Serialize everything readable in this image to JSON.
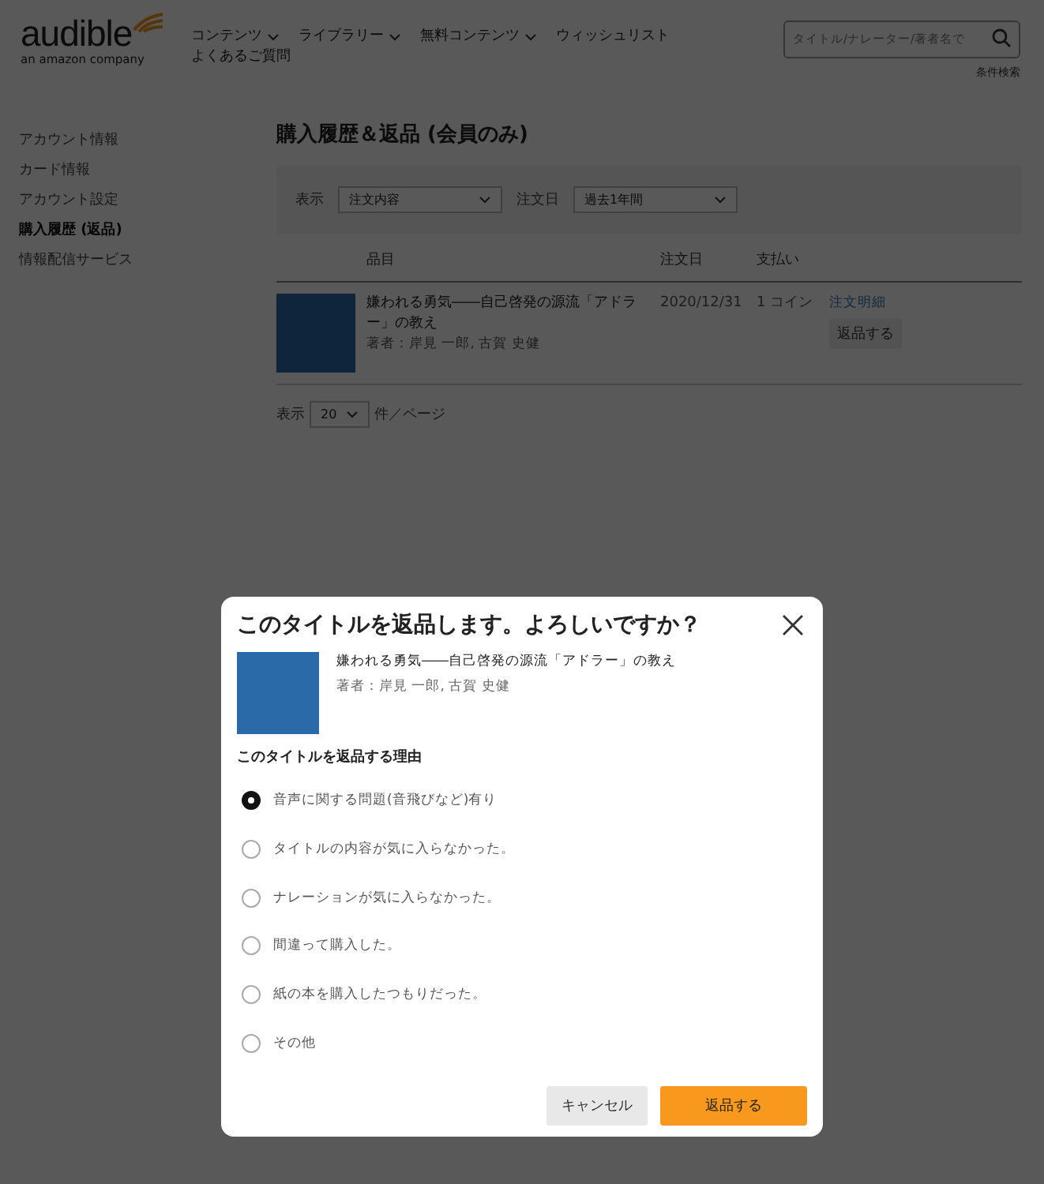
{
  "header": {
    "logo": {
      "name": "audible",
      "tagline": "an amazon company"
    },
    "nav": [
      {
        "label": "コンテンツ",
        "dropdown": true
      },
      {
        "label": "ライブラリー",
        "dropdown": true
      },
      {
        "label": "無料コンテンツ",
        "dropdown": true
      },
      {
        "label": "ウィッシュリスト",
        "dropdown": false
      },
      {
        "label": "よくあるご質問",
        "dropdown": false
      }
    ],
    "search": {
      "placeholder": "タイトル/ナレーター/著者名で"
    },
    "advanced_search": "条件検索"
  },
  "sidebar": {
    "items": [
      {
        "label": "アカウント情報",
        "selected": false
      },
      {
        "label": "カード情報",
        "selected": false
      },
      {
        "label": "アカウント設定",
        "selected": false
      },
      {
        "label": "購入履歴 (返品)",
        "selected": true
      },
      {
        "label": "情報配信サービス",
        "selected": false
      }
    ]
  },
  "main": {
    "title": "購入履歴＆返品 (会員のみ)",
    "filters": [
      {
        "label": "表示",
        "value": "注文内容"
      },
      {
        "label": "注文日",
        "value": "過去1年間"
      }
    ],
    "table": {
      "columns": [
        "品目",
        "注文日",
        "支払い"
      ],
      "rows": [
        {
          "title": "嫌われる勇気――自己啓発の源流「アドラー」の教え",
          "author": "著者：岸見 一郎, 古賀 史健",
          "date": "2020/12/31",
          "payment": "1 コイン",
          "details_link": "注文明細",
          "return_button": "返品する"
        }
      ]
    },
    "paging": {
      "label": "表示",
      "value": "20",
      "suffix": "件／ページ"
    }
  },
  "dialog": {
    "title": "このタイトルを返品します。よろしいですか？",
    "book": {
      "title": "嫌われる勇気――自己啓発の源流「アドラー」の教え",
      "author": "著者：岸見 一郎, 古賀 史健"
    },
    "reason_heading": "このタイトルを返品する理由",
    "reasons": [
      {
        "label": "音声に関する問題(音飛びなど)有り",
        "selected": true
      },
      {
        "label": "タイトルの内容が気に入らなかった。",
        "selected": false
      },
      {
        "label": "ナレーションが気に入らなかった。",
        "selected": false
      },
      {
        "label": "間違って購入した。",
        "selected": false
      },
      {
        "label": "紙の本を購入したつもりだった。",
        "selected": false
      },
      {
        "label": "その他",
        "selected": false
      }
    ],
    "buttons": [
      {
        "label": "キャンセル",
        "kind": "secondary"
      },
      {
        "label": "返品する",
        "kind": "primary"
      }
    ]
  }
}
